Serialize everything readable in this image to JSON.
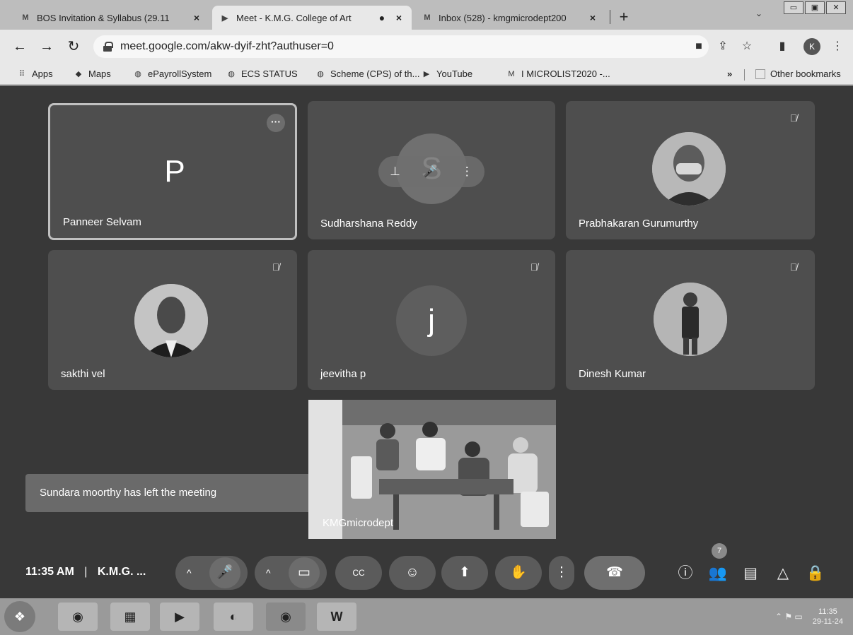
{
  "browser": {
    "tabs": [
      {
        "icon": "gmail-icon",
        "favicon_text": "M",
        "label": "BOS Invitation & Syllabus (29.11",
        "close": "×"
      },
      {
        "icon": "meet-icon",
        "favicon_text": "▶",
        "label": "Meet - K.M.G. College of Art",
        "close": "×",
        "recording": "●"
      },
      {
        "icon": "gmail-icon",
        "favicon_text": "M",
        "label": "Inbox (528) - kmgmicrodept200",
        "close": "×"
      }
    ],
    "new_tab": "+",
    "tab_menu": "⌄",
    "window_controls": [
      "▭",
      "▣",
      "✕"
    ],
    "nav": {
      "back": "←",
      "forward": "→",
      "reload": "↻"
    },
    "url": "meet.google.com/akw-dyif-zht?authuser=0",
    "toolbar_icons": {
      "camera": "■",
      "share": "⇪",
      "star": "☆",
      "sidepanel": "▮",
      "menu": "⋮"
    },
    "profile_initial": "K",
    "bookmarks": [
      {
        "icon": "apps-grid-icon",
        "glyph": "⠿",
        "label": "Apps"
      },
      {
        "icon": "maps-pin-icon",
        "glyph": "◆",
        "label": "Maps"
      },
      {
        "icon": "globe-icon",
        "glyph": "◍",
        "label": "ePayrollSystem"
      },
      {
        "icon": "globe-icon",
        "glyph": "◍",
        "label": "ECS STATUS"
      },
      {
        "icon": "globe-icon",
        "glyph": "◍",
        "label": "Scheme (CPS) of th..."
      },
      {
        "icon": "youtube-icon",
        "glyph": "▶",
        "label": "YouTube"
      },
      {
        "icon": "gmail-icon",
        "glyph": "M",
        "label": "I MICROLIST2020 -..."
      }
    ],
    "bookmarks_overflow": "»",
    "other_bookmarks": "Other bookmarks"
  },
  "meet": {
    "participants": [
      {
        "name": "Panneer Selvam",
        "initial": "P",
        "muted": false
      },
      {
        "name": "Sudharshana Reddy",
        "initial": "S",
        "muted": false
      },
      {
        "name": "Prabhakaran Gurumurthy",
        "muted": true
      },
      {
        "name": "sakthi vel",
        "muted": true
      },
      {
        "name": "jeevitha p",
        "initial": "j",
        "muted": true
      },
      {
        "name": "Dinesh Kumar",
        "muted": true
      }
    ],
    "self_name": "KMGmicrodept",
    "toast": "Sundara moorthy has left the meeting",
    "time": "11:35 AM",
    "separator": "|",
    "meeting_name": "K.M.G. ...",
    "participant_count": "7",
    "hover_icons": {
      "pin": "⊥",
      "mute": "🎤",
      "more": "⋮"
    },
    "more_options_glyph": "···",
    "mute_glyph": "🎙̸",
    "controls": {
      "audio_options": "^",
      "mic": "🎤",
      "video_options": "^",
      "camera": "▭",
      "captions": "CC",
      "emoji": "☺",
      "present": "⬆",
      "raise_hand": "✋",
      "more": "⋮",
      "end_call": "☎",
      "info": "ⓘ",
      "people": "👥",
      "chat": "▤",
      "activities": "△",
      "host_controls": "🔒"
    }
  },
  "taskbar": {
    "start": "❖",
    "apps": [
      {
        "icon": "chrome-icon",
        "glyph": "◉"
      },
      {
        "icon": "file-explorer-icon",
        "glyph": "▦"
      },
      {
        "icon": "media-player-icon",
        "glyph": "▶"
      },
      {
        "icon": "firefox-icon",
        "glyph": "◐"
      },
      {
        "icon": "chrome-icon",
        "glyph": "◉"
      },
      {
        "icon": "word-icon",
        "glyph": "W"
      }
    ],
    "tray_glyphs": "⌃  ⚑  ▭",
    "clock_time": "11:35",
    "clock_date": "29-11-24"
  }
}
